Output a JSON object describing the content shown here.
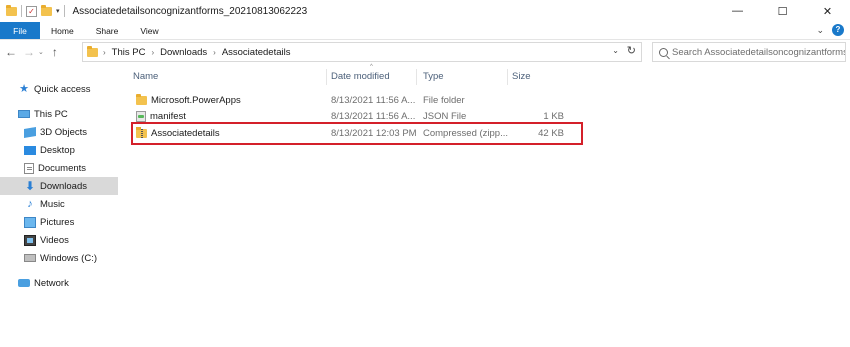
{
  "window": {
    "title": "Associatedetailsoncognizantforms_20210813062223",
    "minimize_glyph": "—",
    "maximize_glyph": "☐",
    "close_glyph": "✕"
  },
  "ribbon": {
    "tabs": [
      "File",
      "Home",
      "Share",
      "View"
    ],
    "help_label": "?"
  },
  "address": {
    "crumbs": [
      "This PC",
      "Downloads",
      "Associatedetails"
    ],
    "search_placeholder": "Search Associatedetailsoncognizantforms_..."
  },
  "nav": {
    "items": [
      {
        "label": "Quick access",
        "icon": "star-icon"
      },
      {
        "label": "This PC",
        "icon": "computer-icon"
      },
      {
        "label": "3D Objects",
        "icon": "cube-icon"
      },
      {
        "label": "Desktop",
        "icon": "desktop-icon"
      },
      {
        "label": "Documents",
        "icon": "document-icon"
      },
      {
        "label": "Downloads",
        "icon": "download-icon",
        "selected": true
      },
      {
        "label": "Music",
        "icon": "music-icon"
      },
      {
        "label": "Pictures",
        "icon": "picture-icon"
      },
      {
        "label": "Videos",
        "icon": "video-icon"
      },
      {
        "label": "Windows (C:)",
        "icon": "drive-icon"
      },
      {
        "label": "Network",
        "icon": "network-icon"
      }
    ]
  },
  "columns": {
    "name": "Name",
    "date": "Date modified",
    "type": "Type",
    "size": "Size"
  },
  "files": [
    {
      "name": "Microsoft.PowerApps",
      "date": "8/13/2021 11:56 A...",
      "type": "File folder",
      "size": "",
      "icon": "folder-icon"
    },
    {
      "name": "manifest",
      "date": "8/13/2021 11:56 A...",
      "type": "JSON File",
      "size": "1 KB",
      "icon": "json-file-icon"
    },
    {
      "name": "Associatedetails",
      "date": "8/13/2021 12:03 PM",
      "type": "Compressed (zipp...",
      "size": "42 KB",
      "icon": "zip-folder-icon"
    }
  ],
  "colors": {
    "accent": "#1979ca",
    "highlight_border": "#d4202a",
    "selected_nav": "#d9d9d9"
  }
}
